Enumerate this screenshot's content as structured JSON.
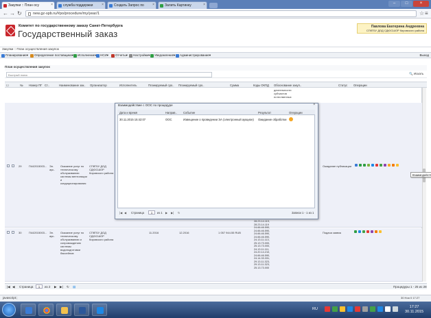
{
  "browser": {
    "tabs": [
      {
        "label": "Закупки :: План осу",
        "active": true
      },
      {
        "label": "служба поддержки",
        "active": false
      },
      {
        "label": "Создать Запрос по",
        "active": false
      },
      {
        "label": "Залить Картинку",
        "active": false
      }
    ],
    "url": "new.gz-spb.ru/#po/procedure/my/year/1"
  },
  "header": {
    "org_line1": "Комитет по государственному заказу Санкт-Петербурга",
    "site_title": "Государственный заказ",
    "user_name": "Павлова Екатерина Андреевна",
    "user_org": "СПбГБУ ДОД СДЮСШОР Кировского района"
  },
  "breadcrumb": "Закупки :: План осуществления закупок",
  "menu": [
    {
      "label": "Планирование",
      "icon": "calendar-icon",
      "color": "#3a7bd5"
    },
    {
      "label": "Определение поставщика",
      "icon": "gear-icon",
      "color": "#d68a1e"
    },
    {
      "label": "Исполнение",
      "icon": "gear-icon",
      "color": "#2f9e44"
    },
    {
      "label": "НСИ",
      "icon": "table-icon",
      "color": "#3a7bd5"
    },
    {
      "label": "Отчеты",
      "icon": "report-icon",
      "color": "#c0392b"
    },
    {
      "label": "Настройки",
      "icon": "wrench-icon",
      "color": "#888888"
    },
    {
      "label": "Уведомления",
      "icon": "bell-icon",
      "color": "#2f9e44"
    },
    {
      "label": "Администрирование",
      "icon": "admin-icon",
      "color": "#3a7bd5"
    }
  ],
  "exit_label": "Выход",
  "grid": {
    "title": "План осуществления закупок",
    "search_placeholder": "Быстрый поиск",
    "search_button": "Искать",
    "columns": [
      "№",
      "Номер ПГ",
      "Ст..",
      "Наименование зак..",
      "Организатор",
      "Исполнитель",
      "Планируемый сро..",
      "Планируемый сро..",
      "Сумма",
      "Коды ОКПД",
      "Обоснование закуп..",
      "Статус",
      "Операции"
    ],
    "top_partial_text": "деятельности\nсубъектов\nестественных",
    "rows": [
      {
        "num": "29",
        "plan_number": "П442015003...",
        "stage": "Эл.\nаук..",
        "name": "Оказание услуг по\nтехническому\nобслуживанию\nсистемы вентиляции\nи\nкондиционирования",
        "organizer": "СПбГБУ ДОД\nСДЮСШОР\nКировского района",
        "status": "Ожидание публикации"
      },
      {
        "num": "30",
        "plan_number": "П442015003...",
        "stage": "Эл.\nаук..",
        "name": "Оказание услуг по\nтехническому\nобслуживанию и\nсопровождению\nсистемы\nводоподготовки\nбассейнов",
        "organizer": "СПбГБУ ДОД\nСДЮСШОР\nКировского района",
        "date1": "11.2016",
        "date2": "12.2016",
        "sum": "1 057 944.55 RUB",
        "okpd": "28.23.14.119,\n28.23.14.119\n24.66.46.590,\n24.66.46.590,\n24.66.46.590,\n24.66.46.590,\n24.13.11.113,\n25.13.73.000,\n25.13.73.000,\n24.13.11.111,\n24.20.14.210,\n24.66.46.590,\n24.14.33.331,\n29.13.11.323,\n29.13.11.323,\n25.13.73.000",
        "okpd_top": "28.23.14.119,\n28.23.14.119",
        "status": "Подача заявок"
      }
    ],
    "row29_partial_okpd": "",
    "pager": {
      "page_label": "Страница",
      "page_value": "1",
      "of_label": "из 2",
      "summary": "Процедуры 1 - 25 из 28"
    }
  },
  "modal": {
    "title": "Взаимодействие с ООС по процедуре",
    "columns": [
      "Дата и время",
      "Направ..",
      "Событие",
      "Результат",
      "Операции"
    ],
    "rows": [
      {
        "datetime": "30.11.2015 15:42:07",
        "direction": "ООС",
        "event": "Извещение о проведении ЭА (электронный аукцион)",
        "result": "Ожидание обработки"
      }
    ],
    "pager": {
      "page_label": "Страница",
      "page_value": "1",
      "of_label": "из 1",
      "summary": "Записи 1 - 1 из 1"
    }
  },
  "tooltip": "Взаимодействие с ООС",
  "status_text": "javascript:;",
  "last_modified": "30 Ноя 0 17:27",
  "taskbar": {
    "lang": "RU",
    "time": "17:27",
    "date": "30.11.2015"
  }
}
